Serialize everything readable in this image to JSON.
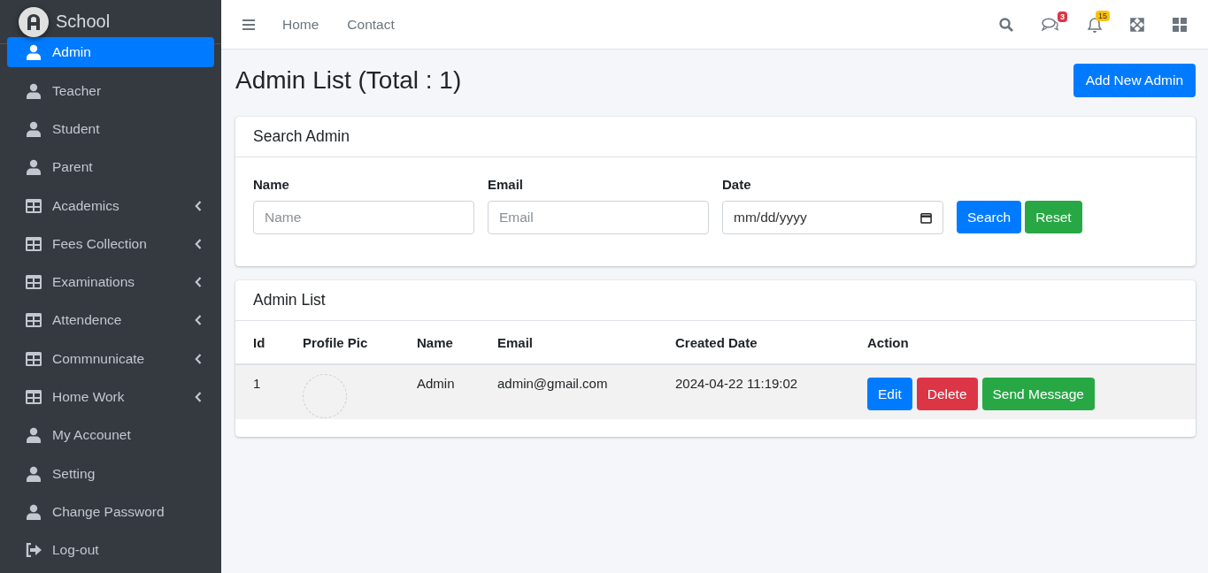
{
  "brand": {
    "name": "School"
  },
  "sidebar": {
    "items": [
      {
        "label": "Admin",
        "kind": "user",
        "submenu": false,
        "selected": true
      },
      {
        "label": "Teacher",
        "kind": "user",
        "submenu": false,
        "selected": false
      },
      {
        "label": "Student",
        "kind": "user",
        "submenu": false,
        "selected": false
      },
      {
        "label": "Parent",
        "kind": "user",
        "submenu": false,
        "selected": false
      },
      {
        "label": "Academics",
        "kind": "group",
        "submenu": true,
        "selected": false
      },
      {
        "label": "Fees Collection",
        "kind": "group",
        "submenu": true,
        "selected": false
      },
      {
        "label": "Examinations",
        "kind": "group",
        "submenu": true,
        "selected": false
      },
      {
        "label": "Attendence",
        "kind": "group",
        "submenu": true,
        "selected": false
      },
      {
        "label": "Commnunicate",
        "kind": "group",
        "submenu": true,
        "selected": false
      },
      {
        "label": "Home Work",
        "kind": "group",
        "submenu": true,
        "selected": false
      },
      {
        "label": "My Accounet",
        "kind": "user",
        "submenu": false,
        "selected": false
      },
      {
        "label": "Setting",
        "kind": "user",
        "submenu": false,
        "selected": false
      },
      {
        "label": "Change Password",
        "kind": "user",
        "submenu": false,
        "selected": false
      },
      {
        "label": "Log-out",
        "kind": "logout",
        "submenu": false,
        "selected": false
      }
    ]
  },
  "topbar": {
    "links": [
      "Home",
      "Contact"
    ],
    "messages_badge": "3",
    "notifications_badge": "15"
  },
  "page": {
    "title": "Admin List (Total : 1)",
    "add_button": "Add New Admin"
  },
  "search_card": {
    "title": "Search Admin",
    "fields": [
      {
        "label": "Name",
        "placeholder": "Name",
        "kind": "text"
      },
      {
        "label": "Email",
        "placeholder": "Email",
        "kind": "text"
      },
      {
        "label": "Date",
        "placeholder": "mm/dd/yyyy",
        "kind": "date"
      }
    ],
    "buttons": [
      {
        "label": "Search",
        "kind": "primary"
      },
      {
        "label": "Reset",
        "kind": "success"
      }
    ]
  },
  "list_card": {
    "title": "Admin List",
    "columns": [
      "Id",
      "Profile Pic",
      "Name",
      "Email",
      "Created Date",
      "Action"
    ],
    "rows": [
      {
        "id": "1",
        "name": "Admin",
        "email": "admin@gmail.com",
        "created": "2024-04-22 11:19:02",
        "actions": [
          {
            "label": "Edit",
            "kind": "primary"
          },
          {
            "label": "Delete",
            "kind": "danger"
          },
          {
            "label": "Send Message",
            "kind": "success"
          }
        ]
      }
    ]
  }
}
